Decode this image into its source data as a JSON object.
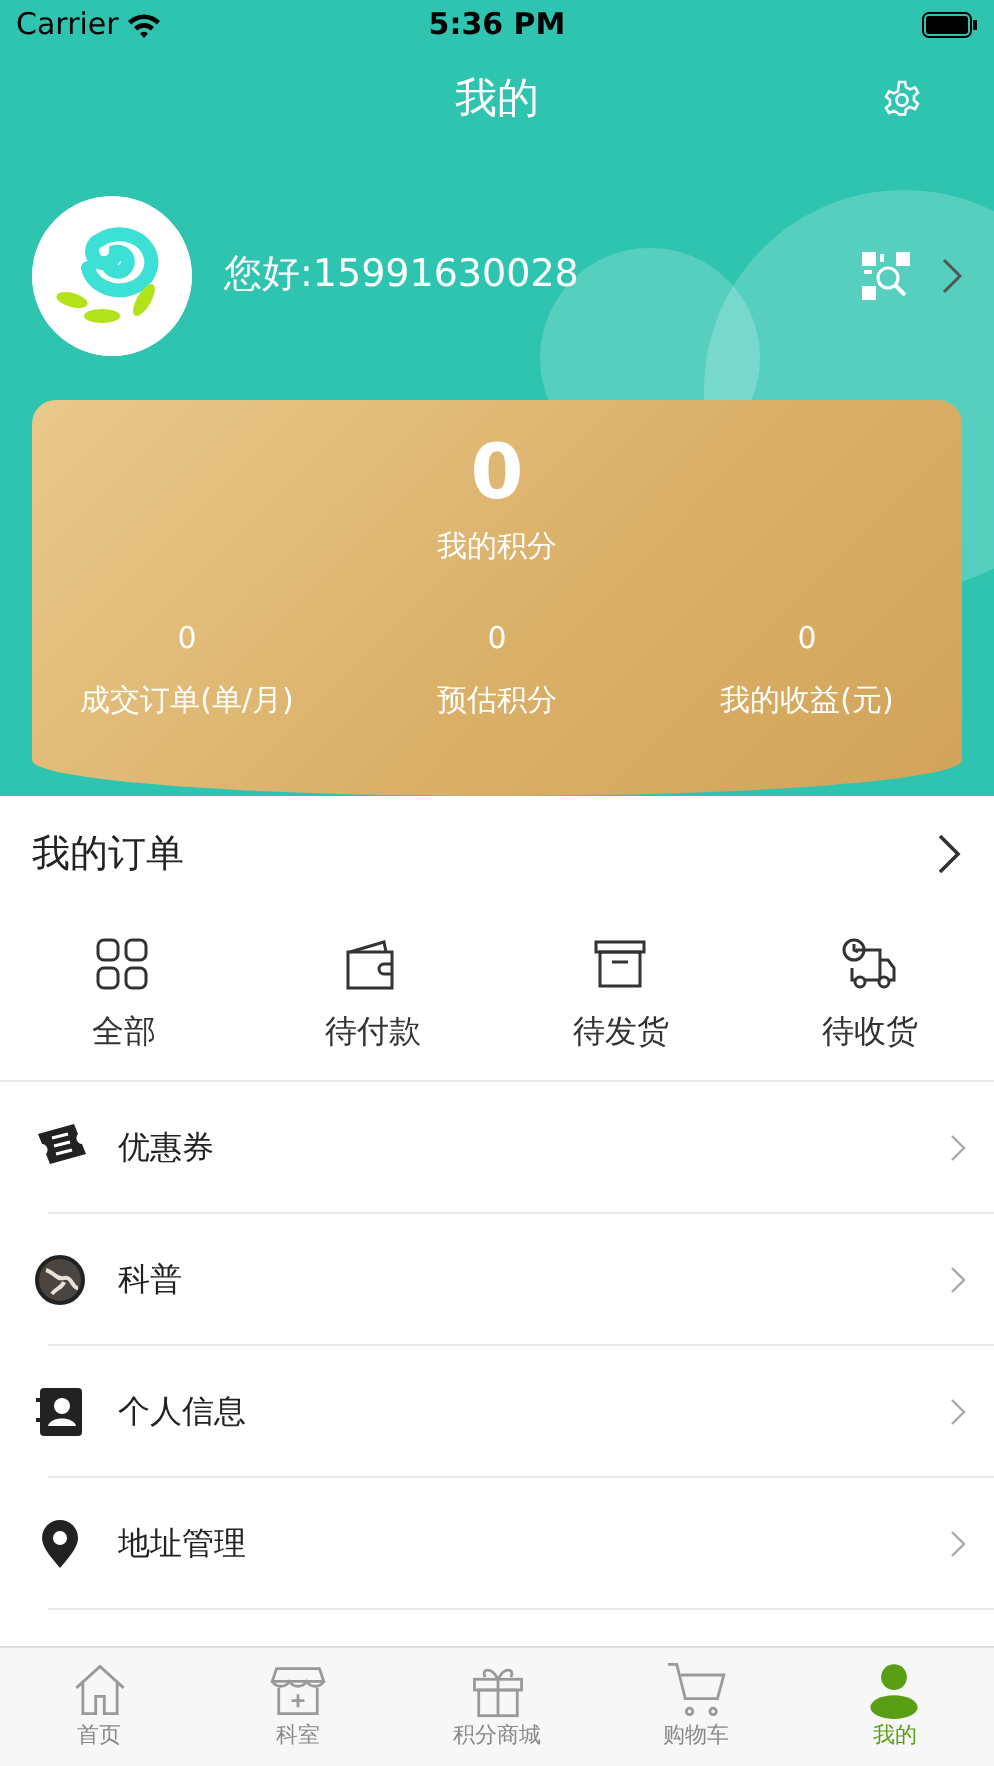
{
  "status_bar": {
    "carrier": "Carrier",
    "time": "5:36 PM"
  },
  "header": {
    "title": "我的",
    "greeting": "您好:15991630028"
  },
  "points_card": {
    "total": "0",
    "total_label": "我的积分",
    "stats": [
      {
        "value": "0",
        "label": "成交订单(单/月)"
      },
      {
        "value": "0",
        "label": "预估积分"
      },
      {
        "value": "0",
        "label": "我的收益(元)"
      }
    ]
  },
  "orders": {
    "title": "我的订单",
    "items": [
      {
        "label": "全部"
      },
      {
        "label": "待付款"
      },
      {
        "label": "待发货"
      },
      {
        "label": "待收货"
      }
    ]
  },
  "menu": [
    {
      "label": "优惠券"
    },
    {
      "label": "科普"
    },
    {
      "label": "个人信息"
    },
    {
      "label": "地址管理"
    }
  ],
  "tab_bar": [
    {
      "label": "首页",
      "selected": false
    },
    {
      "label": "科室",
      "selected": false
    },
    {
      "label": "积分商城",
      "selected": false
    },
    {
      "label": "购物车",
      "selected": false
    },
    {
      "label": "我的",
      "selected": true
    }
  ]
}
